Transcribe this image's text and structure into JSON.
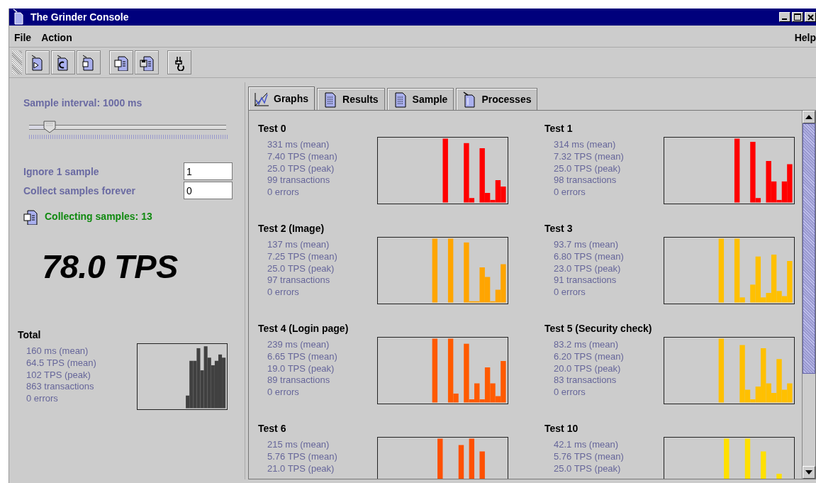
{
  "window": {
    "title": "The Grinder Console"
  },
  "menu": {
    "left": [
      "File",
      "Action"
    ],
    "right": [
      "Help"
    ]
  },
  "toolbar": [
    [
      {
        "kind": "start"
      },
      {
        "kind": "reset"
      },
      {
        "kind": "stop"
      }
    ],
    [
      {
        "kind": "open"
      },
      {
        "kind": "save"
      }
    ],
    [
      {
        "kind": "distribute"
      }
    ]
  ],
  "sample_panel": {
    "interval_label": "Sample interval: 1000 ms",
    "slider": {
      "level": 0.1
    },
    "ignore": {
      "label": "Ignore 1 sample",
      "value": "1"
    },
    "collect": {
      "label": "Collect samples forever",
      "value": "0"
    },
    "status": "Collecting samples: 13",
    "tps": "78.0 TPS",
    "total": {
      "title": "Total",
      "stats": [
        "160 ms (mean)",
        "64.5 TPS (mean)",
        "102 TPS (peak)",
        "863 transactions",
        "0 errors"
      ]
    }
  },
  "tabs": [
    {
      "label": "Graphs",
      "kind": "graph",
      "selected": true
    },
    {
      "label": "Results",
      "kind": "document",
      "selected": false
    },
    {
      "label": "Sample",
      "kind": "document",
      "selected": false
    },
    {
      "label": "Processes",
      "kind": "grinder",
      "selected": false
    }
  ],
  "tests": [
    {
      "title": "Test 0",
      "color": "#ff0000",
      "stats": [
        "331 ms (mean)",
        "7.40 TPS (mean)",
        "25.0 TPS (peak)",
        "99 transactions",
        "0 errors"
      ]
    },
    {
      "title": "Test 1",
      "color": "#ff0000",
      "stats": [
        "314 ms (mean)",
        "7.32 TPS (mean)",
        "25.0 TPS (peak)",
        "98 transactions",
        "0 errors"
      ]
    },
    {
      "title": "Test 2 (Image)",
      "color": "#ffa500",
      "stats": [
        "137 ms (mean)",
        "7.25 TPS (mean)",
        "25.0 TPS (peak)",
        "97 transactions",
        "0 errors"
      ]
    },
    {
      "title": "Test 3",
      "color": "#ffc000",
      "stats": [
        "93.7 ms (mean)",
        "6.80 TPS (mean)",
        "23.0 TPS (peak)",
        "91 transactions",
        "0 errors"
      ]
    },
    {
      "title": "Test 4 (Login page)",
      "color": "#ff5a00",
      "stats": [
        "239 ms (mean)",
        "6.65 TPS (mean)",
        "19.0 TPS (peak)",
        "89 transactions",
        "0 errors"
      ]
    },
    {
      "title": "Test 5 (Security check)",
      "color": "#ffc000",
      "stats": [
        "83.2 ms (mean)",
        "6.20 TPS (mean)",
        "20.0 TPS (peak)",
        "83 transactions",
        "0 errors"
      ]
    },
    {
      "title": "Test 6",
      "color": "#ff5000",
      "stats": [
        "215 ms (mean)",
        "5.76 TPS (mean)",
        "21.0 TPS (peak)"
      ]
    },
    {
      "title": "Test 10",
      "color": "#ffe000",
      "stats": [
        "42.1 ms (mean)",
        "5.76 TPS (mean)",
        "25.0 TPS (peak)"
      ]
    }
  ]
}
